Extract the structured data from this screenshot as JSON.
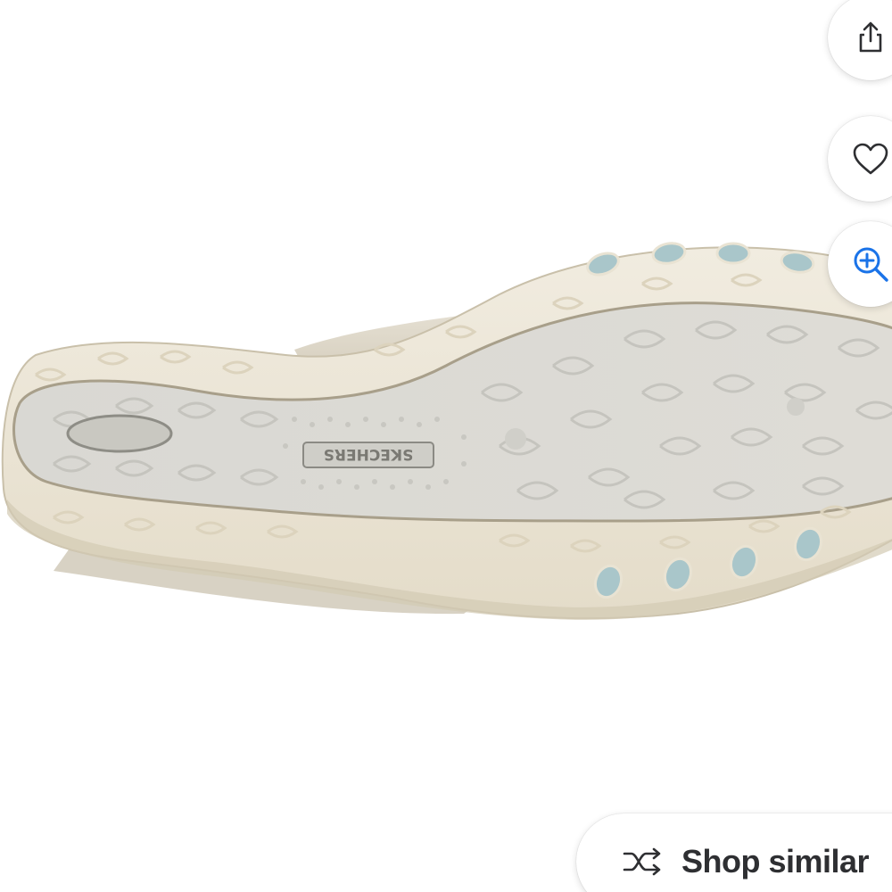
{
  "product": {
    "image_description_icon": "shoe-sole-image",
    "brand_mark": "SKECHERS"
  },
  "actions": {
    "share_icon": "share-icon",
    "favorite_icon": "heart-icon",
    "zoom_icon": "zoom-in-icon"
  },
  "shop_similar": {
    "label": "Shop similar",
    "icon": "shuffle-icon"
  },
  "colors": {
    "accent_blue": "#1a73e8",
    "text_dark": "#2e2f32",
    "sole_cream": "#ece6d6",
    "sole_gray": "#dcdcd9",
    "sole_blue_nubs": "#a9c6ca"
  }
}
